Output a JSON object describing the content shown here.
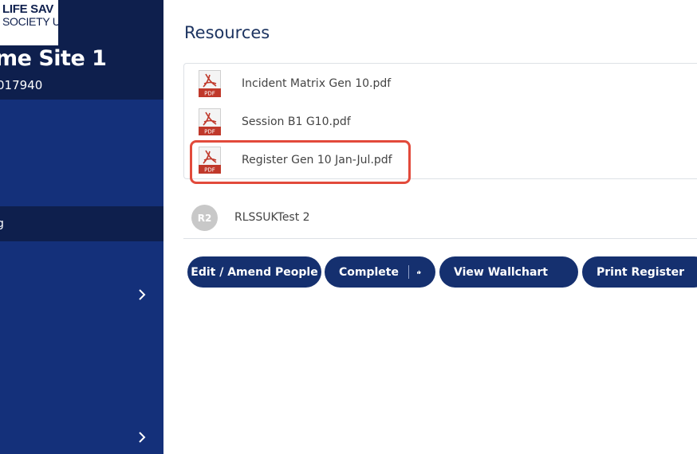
{
  "sidebar": {
    "logo_line1": "LIFE SAV",
    "logo_line2": "SOCIETY U",
    "site_title": "me Site 1",
    "site_id": "017940",
    "active_item_label": "g"
  },
  "resources": {
    "title": "Resources",
    "files": [
      {
        "name": "Incident Matrix Gen 10.pdf",
        "icon": "pdf-icon",
        "icon_text": "PDF"
      },
      {
        "name": "Session B1 G10.pdf",
        "icon": "pdf-icon",
        "icon_text": "PDF"
      },
      {
        "name": "Register Gen 10 Jan-Jul.pdf",
        "icon": "pdf-icon",
        "icon_text": "PDF"
      }
    ]
  },
  "person": {
    "initials": "R2",
    "name": "RLSSUKTest 2"
  },
  "actions": {
    "edit_label": "Edit / Amend People",
    "complete_label": "Complete",
    "wallchart_label": "View Wallchart",
    "print_label": "Print Register"
  },
  "colors": {
    "sidebar": "#14307a",
    "sidebar_dark": "#0e1f4d",
    "button": "#15306f",
    "highlight": "#e24a3b",
    "pdf_red": "#c0392b"
  }
}
